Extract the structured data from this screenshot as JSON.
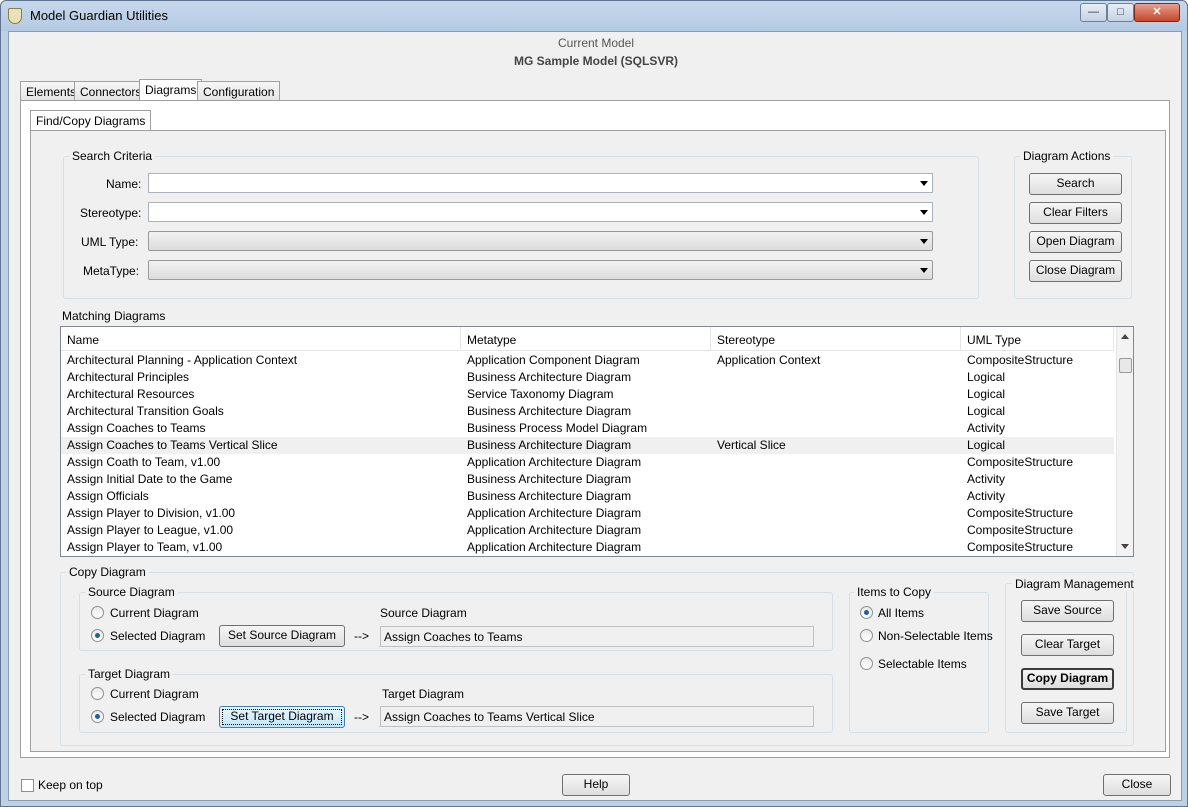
{
  "window": {
    "title": "Model Guardian Utilities",
    "minimize": "—",
    "maximize": "□",
    "close": "✕"
  },
  "header": {
    "current_model_label": "Current Model",
    "model_name": "MG Sample Model (SQLSVR)"
  },
  "tabs": [
    "Elements",
    "Connectors",
    "Diagrams",
    "Configuration"
  ],
  "subtab": "Find/Copy Diagrams",
  "search": {
    "title": "Search Criteria",
    "name_label": "Name:",
    "stereotype_label": "Stereotype:",
    "uml_type_label": "UML Type:",
    "metatype_label": "MetaType:",
    "name_value": "",
    "stereotype_value": "",
    "uml_type_value": "",
    "metatype_value": ""
  },
  "actions": {
    "title": "Diagram Actions",
    "search": "Search",
    "clear_filters": "Clear Filters",
    "open_diagram": "Open Diagram",
    "close_diagram": "Close Diagram"
  },
  "matching": {
    "title": "Matching Diagrams",
    "columns": [
      "Name",
      "Metatype",
      "Stereotype",
      "UML Type"
    ],
    "rows": [
      [
        "Architectural Planning - Application Context",
        "Application Component Diagram",
        "Application Context",
        "CompositeStructure"
      ],
      [
        "Architectural Principles",
        "Business Architecture Diagram",
        "",
        "Logical"
      ],
      [
        "Architectural Resources",
        "Service Taxonomy Diagram",
        "",
        "Logical"
      ],
      [
        "Architectural Transition Goals",
        "Business Architecture Diagram",
        "",
        "Logical"
      ],
      [
        "Assign Coaches to Teams",
        "Business Process Model Diagram",
        "",
        "Activity"
      ],
      [
        "Assign Coaches to Teams Vertical Slice",
        "Business Architecture Diagram",
        "Vertical Slice",
        "Logical"
      ],
      [
        "Assign Coath to Team, v1.00",
        "Application Architecture Diagram",
        "",
        "CompositeStructure"
      ],
      [
        "Assign Initial Date to the Game",
        "Business Architecture Diagram",
        "",
        "Activity"
      ],
      [
        "Assign Officials",
        "Business Architecture Diagram",
        "",
        "Activity"
      ],
      [
        "Assign Player to Division, v1.00",
        "Application Architecture Diagram",
        "",
        "CompositeStructure"
      ],
      [
        "Assign Player to League, v1.00",
        "Application Architecture Diagram",
        "",
        "CompositeStructure"
      ],
      [
        "Assign Player to Team, v1.00",
        "Application Architecture Diagram",
        "",
        "CompositeStructure"
      ]
    ]
  },
  "copy": {
    "title": "Copy Diagram",
    "source_group": "Source Diagram",
    "target_group": "Target Diagram",
    "current_diagram": "Current Diagram",
    "selected_diagram": "Selected Diagram",
    "set_source": "Set Source Diagram",
    "set_target": "Set Target Diagram",
    "arrow": "-->",
    "source_label": "Source Diagram",
    "target_label": "Target Diagram",
    "source_value": "Assign Coaches to Teams",
    "target_value": "Assign Coaches to Teams Vertical Slice"
  },
  "items_to_copy": {
    "title": "Items to Copy",
    "all": "All Items",
    "non_selectable": "Non-Selectable Items",
    "selectable": "Selectable Items"
  },
  "management": {
    "title": "Diagram Management",
    "save_source": "Save Source",
    "clear_target": "Clear Target",
    "copy_diagram": "Copy Diagram",
    "save_target": "Save Target"
  },
  "footer": {
    "keep_on_top": "Keep on top",
    "help": "Help",
    "close": "Close"
  }
}
